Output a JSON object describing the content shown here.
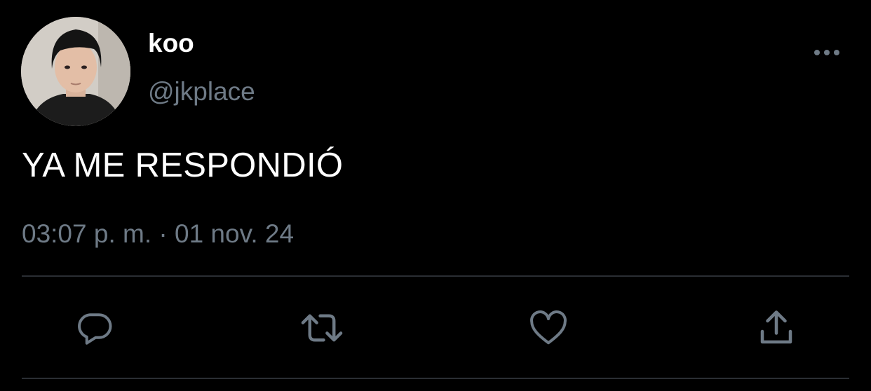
{
  "tweet": {
    "display_name": "koo",
    "handle": "@jkplace",
    "text": "YA ME RESPONDIÓ",
    "timestamp": "03:07 p. m. · 01 nov. 24"
  },
  "icons": {
    "more": "more-horizontal-icon",
    "reply": "reply-icon",
    "retweet": "retweet-icon",
    "like": "heart-icon",
    "share": "share-icon"
  },
  "colors": {
    "background": "#000000",
    "primary_text": "#ffffff",
    "secondary_text": "#6e7a86",
    "divider": "#2a2e33"
  }
}
